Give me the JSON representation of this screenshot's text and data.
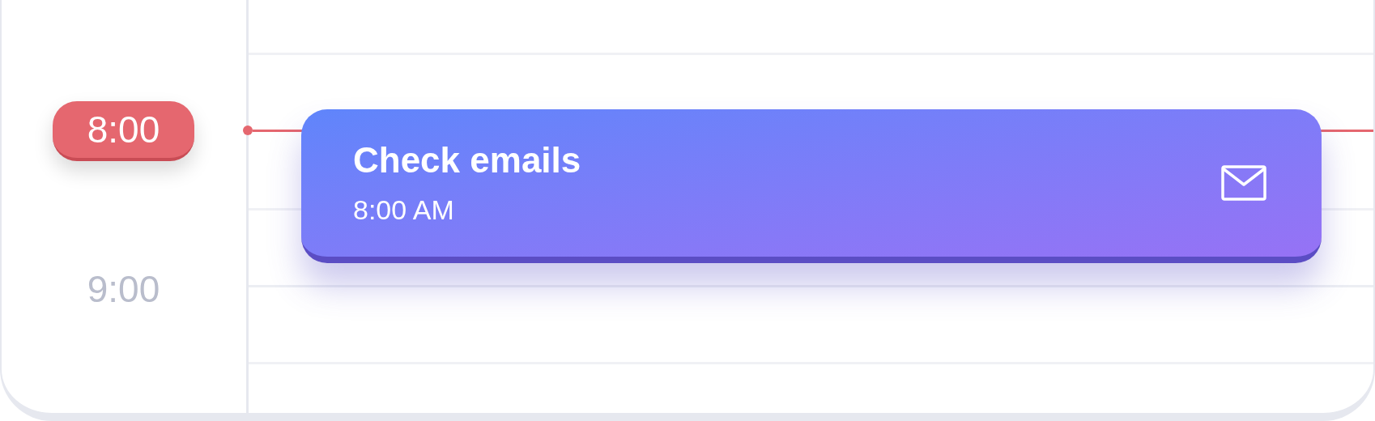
{
  "time_labels": [
    {
      "text": "8:00",
      "current": true
    },
    {
      "text": "9:00",
      "current": false
    }
  ],
  "event": {
    "title": "Check emails",
    "time": "8:00 AM"
  }
}
